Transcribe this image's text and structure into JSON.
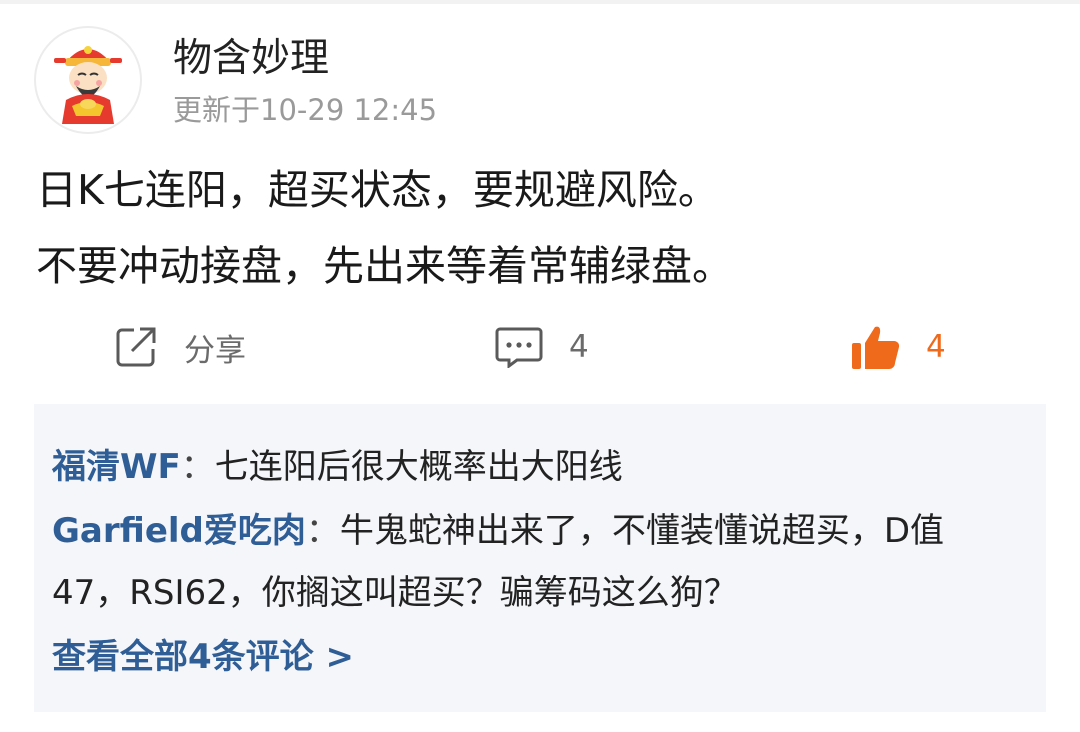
{
  "author": {
    "name": "物含妙理",
    "updated": "更新于10-29 12:45",
    "avatar_icon": "god-of-wealth-avatar-icon"
  },
  "post": {
    "lines": [
      "日K七连阳，超买状态，要规避风险。",
      "不要冲动接盘，先出来等着常辅绿盘。"
    ]
  },
  "actions": {
    "share_label": "分享",
    "share_icon": "share-icon",
    "comment_count": "4",
    "comment_icon": "comment-icon",
    "like_count": "4",
    "like_icon": "thumbs-up-icon",
    "like_color": "#f06a1c"
  },
  "comments": {
    "items": [
      {
        "user": "福清WF",
        "sep": "：",
        "text": "七连阳后很大概率出大阳线"
      },
      {
        "user": "Garfield爱吃肉",
        "sep": "：",
        "text_line1": "牛鬼蛇神出来了，不懂装懂说超买，D值",
        "text_line2": "47，RSI62，你搁这叫超买？骗筹码这么狗？"
      }
    ],
    "view_all": "查看全部4条评论 >"
  },
  "colors": {
    "link_blue": "#2f5d95",
    "comment_bg": "#f4f6f9",
    "muted_gray": "#9a9a9a"
  }
}
